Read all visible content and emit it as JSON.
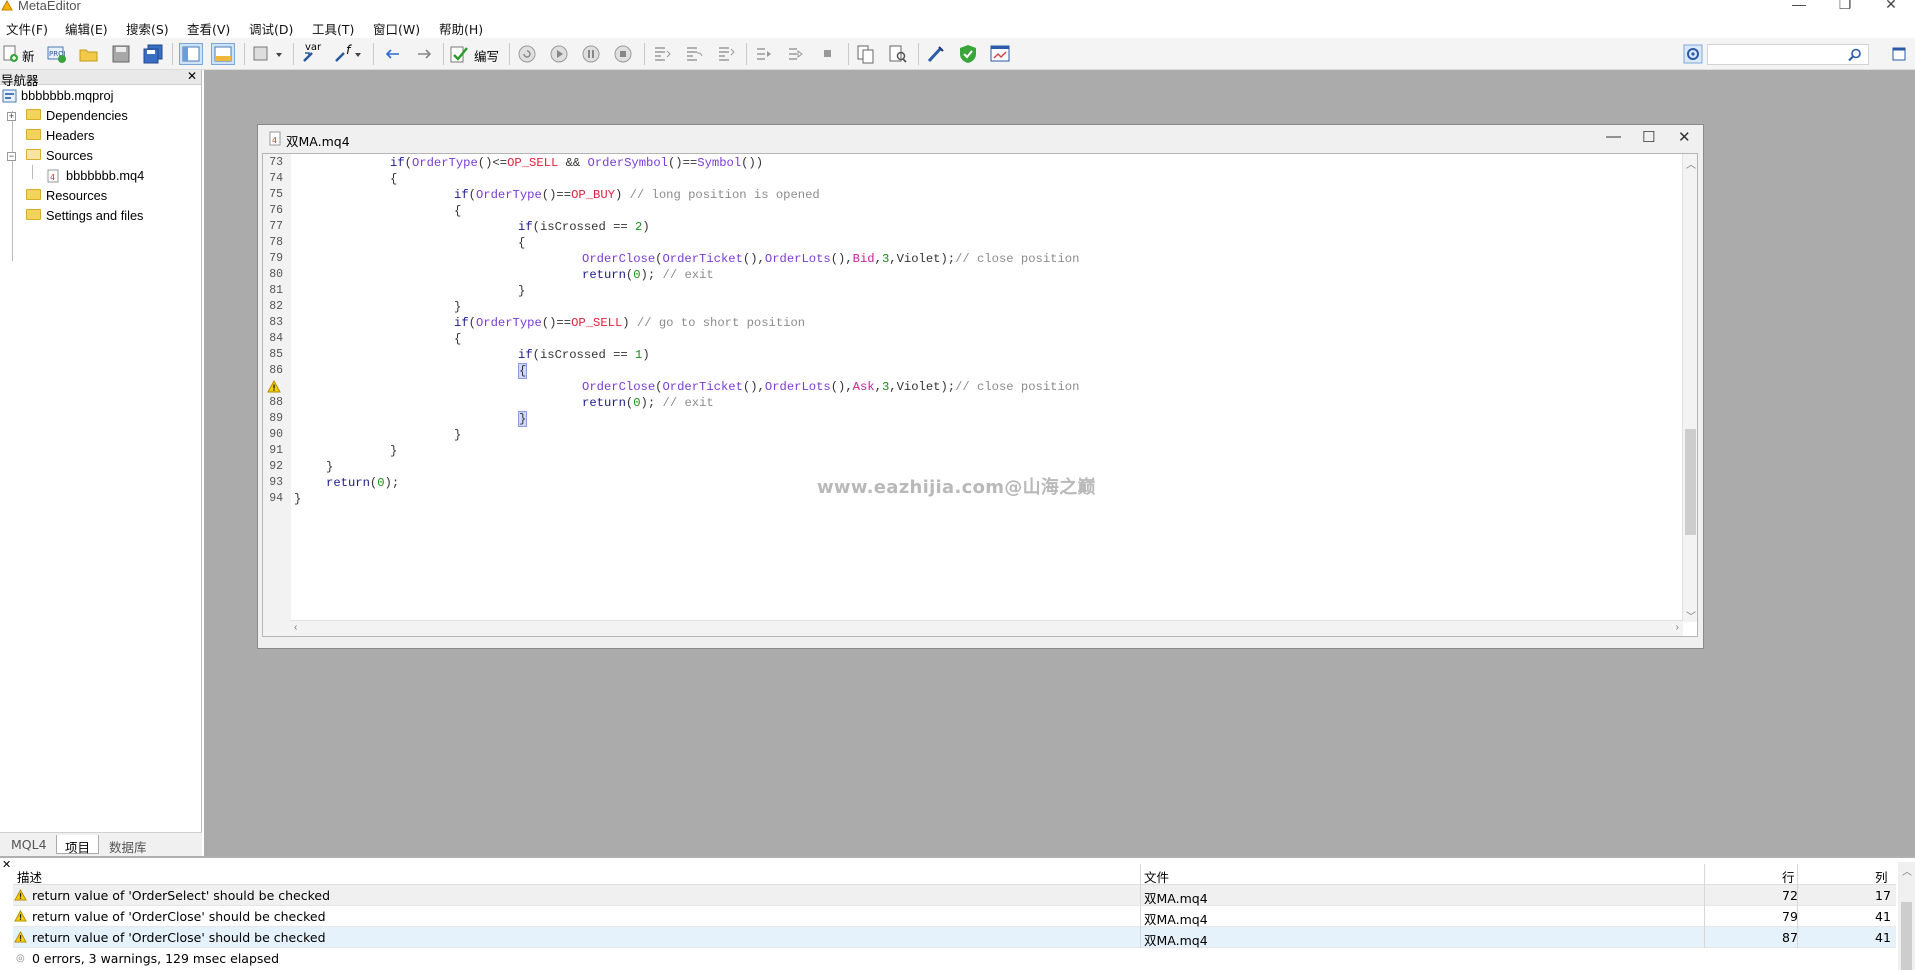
{
  "window": {
    "title": "MetaEditor",
    "controls": [
      "—",
      "❐",
      "✕"
    ]
  },
  "menubar": [
    "文件(F)",
    "编辑(E)",
    "搜索(S)",
    "查看(V)",
    "调试(D)",
    "工具(T)",
    "窗口(W)",
    "帮助(H)"
  ],
  "toolbar": {
    "new_label": "新",
    "compile_label": "编写",
    "var_label": "var",
    "fx_label": "f"
  },
  "navigator": {
    "title": "导航器",
    "project": "bbbbbbb.mqproj",
    "items": [
      {
        "label": "Dependencies"
      },
      {
        "label": "Headers"
      },
      {
        "label": "Sources"
      },
      {
        "label": "bbbbbbb.mq4"
      },
      {
        "label": "Resources"
      },
      {
        "label": "Settings and files"
      }
    ],
    "tabs": [
      "MQL4",
      "项目",
      "数据库"
    ]
  },
  "editor": {
    "tab_title": "双MA.mq4",
    "line_numbers": [
      "73",
      "74",
      "75",
      "76",
      "77",
      "78",
      "79",
      "80",
      "81",
      "82",
      "83",
      "84",
      "85",
      "86",
      "87",
      "88",
      "89",
      "90",
      "91",
      "92",
      "93",
      "94"
    ],
    "watermark": "www.eazhijia.com@山海之巅"
  },
  "errors": {
    "columns": {
      "desc": "描述",
      "file": "文件",
      "line": "行",
      "col": "列"
    },
    "rows": [
      {
        "desc": "return value of 'OrderSelect' should be checked",
        "file": "双MA.mq4",
        "line": "72",
        "col": "17"
      },
      {
        "desc": "return value of 'OrderClose' should be checked",
        "file": "双MA.mq4",
        "line": "79",
        "col": "41"
      },
      {
        "desc": "return value of 'OrderClose' should be checked",
        "file": "双MA.mq4",
        "line": "87",
        "col": "41"
      }
    ],
    "summary": "0 errors, 3 warnings, 129 msec elapsed"
  },
  "colors": {
    "keyword": "#1a1a8c",
    "function": "#7b3bd6",
    "constant": "#e0213d",
    "number": "#1a8c1a",
    "comment": "#8c8c8c",
    "selection": "#e5f1fb"
  }
}
